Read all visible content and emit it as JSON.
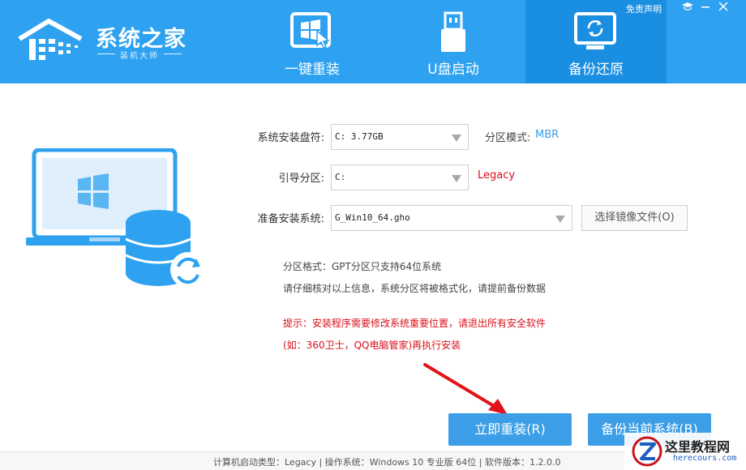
{
  "app": {
    "logo_title": "系统之家",
    "logo_subtitle": "装机大师",
    "disclaimer": "免责声明"
  },
  "tabs": [
    {
      "label": "一键重装",
      "icon": "windows-install-icon",
      "active": false
    },
    {
      "label": "U盘启动",
      "icon": "usb-drive-icon",
      "active": false
    },
    {
      "label": "备份还原",
      "icon": "backup-restore-icon",
      "active": true
    }
  ],
  "form": {
    "install_drive_label": "系统安装盘符:",
    "install_drive_value": "C:  3.77GB",
    "partition_mode_label": "分区模式:",
    "partition_mode_value": "MBR",
    "boot_partition_label": "引导分区:",
    "boot_partition_value": "C:",
    "boot_mode_value": "Legacy",
    "prepare_system_label": "准备安装系统:",
    "prepare_system_value": "G_Win10_64.gho",
    "browse_button": "选择镜像文件(O)"
  },
  "info": {
    "partition_format": "分区格式：GPT分区只支持64位系统",
    "check_notice": "请仔细核对以上信息，系统分区将被格式化，请提前备份数据",
    "warning_line1": "提示：安装程序需要修改系统重要位置，请退出所有安全软件",
    "warning_line2": "(如：360卫士，QQ电脑管家)再执行安装"
  },
  "buttons": {
    "install_now": "立即重装(R)",
    "backup_current": "备份当前系统(B)"
  },
  "footer": {
    "status": "计算机启动类型：Legacy | 操作系统：Windows 10 专业版 64位 | 软件版本：1.2.0.0"
  },
  "watermark": {
    "title": "这里教程网",
    "subtitle": "herecours.com"
  },
  "colors": {
    "header_bg": "#2ea2f0",
    "active_tab_bg": "#1a8ee0",
    "primary_button": "#3c9ee6",
    "warning_text": "#d8101a",
    "info_value": "#3c9ee6"
  }
}
